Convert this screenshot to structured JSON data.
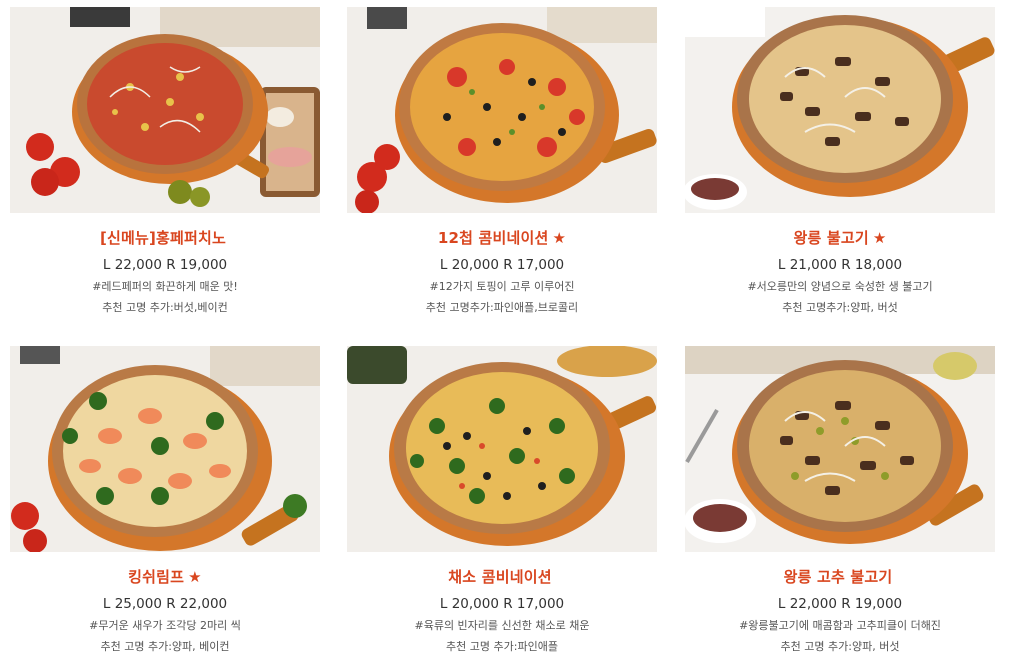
{
  "menu": {
    "items": [
      {
        "name": "[신메뉴]홍페퍼치노",
        "star": "",
        "price": "L 22,000 R 19,000",
        "desc": "#레드페퍼의 화끈하게 매운 맛!",
        "extra": "추천 고명 추가:버섯,베이컨",
        "image_alt": "pepperoni pizza with red pepper on wooden board"
      },
      {
        "name": "12첩 콤비네이션",
        "star": "★",
        "price": "L 20,000 R 17,000",
        "desc": "#12가지 토핑이 고루 이루어진",
        "extra": "추천 고명추가:파인애플,브로콜리",
        "image_alt": "combination pizza with olives and tomatoes"
      },
      {
        "name": "왕릉 불고기",
        "star": "★",
        "price": "L 21,000 R 18,000",
        "desc": "#서오릉만의 양념으로 숙성한 생 불고기",
        "extra": "추천 고명추가:양파, 버섯",
        "image_alt": "bulgogi pizza with onions"
      },
      {
        "name": "킹쉬림프",
        "star": "★",
        "price": "L 25,000 R 22,000",
        "desc": "#무거운 새우가 조각당 2마리 씩",
        "extra": "추천 고명 추가:양파, 베이컨",
        "image_alt": "shrimp pizza with broccoli"
      },
      {
        "name": "채소 콤비네이션",
        "star": "",
        "price": "L 20,000 R 17,000",
        "desc": "#육류의 빈자리를 신선한 채소로 채운",
        "extra": "추천 고명 추가:파인애플",
        "image_alt": "vegetable combination pizza"
      },
      {
        "name": "왕릉 고추 불고기",
        "star": "",
        "price": "L 22,000 R 19,000",
        "desc": "#왕릉불고기에 매콤함과 고추피클이 더해진",
        "extra": "추천 고명 추가:양파, 버섯",
        "image_alt": "spicy pepper bulgogi pizza"
      }
    ]
  },
  "colors": {
    "accent": "#d9461f",
    "board": "#d4772a",
    "crust": "#b06a3a",
    "background": "#f1ede7"
  }
}
